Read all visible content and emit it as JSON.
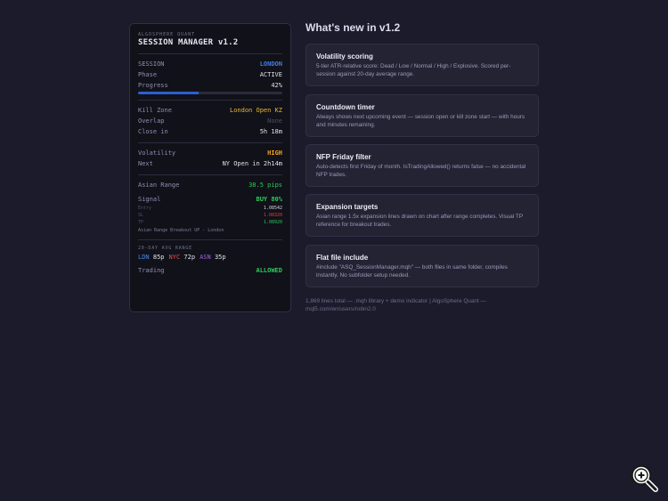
{
  "panel": {
    "brand": "ALGOSPHERE QUANT",
    "title": "SESSION MANAGER v1.2",
    "session_label": "SESSION",
    "session_value": "LONDON",
    "phase_label": "Phase",
    "phase_value": "ACTIVE",
    "progress_label": "Progress",
    "progress_value": "42%",
    "progress_fraction": 0.42,
    "killzone_label": "Kill Zone",
    "killzone_value": "London Open KZ",
    "overlap_label": "Overlap",
    "overlap_value": "None",
    "closein_label": "Close in",
    "closein_value": "5h 18m",
    "volatility_label": "Volatility",
    "volatility_value": "HIGH",
    "next_label": "Next",
    "next_value": "NY Open in 2h14m",
    "asian_label": "Asian Range",
    "asian_value": "38.5 pips",
    "signal_label": "Signal",
    "signal_value": "BUY 80%",
    "entry_label": "Entry",
    "entry_value": "1.08542",
    "sl_label": "SL",
    "sl_value": "1.08320",
    "tp_label": "TP",
    "tp_value": "1.08920",
    "signal_note": "Asian Range Breakout UP - London",
    "avg_header": "20-DAY AVG RANGE",
    "avg": [
      {
        "tag": "LDN",
        "val": "85p"
      },
      {
        "tag": "NYC",
        "val": "72p"
      },
      {
        "tag": "ASN",
        "val": "35p"
      }
    ],
    "trading_label": "Trading",
    "trading_value": "ALLOWED"
  },
  "whats_new": {
    "heading": "What's new in v1.2",
    "cards": [
      {
        "title": "Volatility scoring",
        "desc": "5-tier ATR-relative score: Dead / Low / Normal / High / Explosive. Scored per-session against 20-day average range."
      },
      {
        "title": "Countdown timer",
        "desc": "Always shows next upcoming event — session open or kill zone start — with hours and minutes remaining."
      },
      {
        "title": "NFP Friday filter",
        "desc": "Auto-detects first Friday of month. IsTradingAllowed() returns false — no accidental NFP trades."
      },
      {
        "title": "Expansion targets",
        "desc": "Asian range 1.5x expansion lines drawn on chart after range completes. Visual TP reference for breakout trades."
      },
      {
        "title": "Flat file include",
        "desc": "#include \"ASQ_SessionManager.mqh\" — both files in same folder, compiles instantly. No subfolder setup needed."
      }
    ],
    "footer": "1,869 lines total — .mqh library + demo indicator | AlgoSphere Quant — mql5.com/en/users/robin2.0"
  },
  "icons": {
    "zoom": "zoom-in-icon"
  },
  "colors": {
    "accent_blue": "#3e7ee8",
    "green": "#2ec95a",
    "orange": "#f2a51a",
    "amber": "#e8b832",
    "red": "#e53e3e",
    "purple": "#a064e0"
  }
}
